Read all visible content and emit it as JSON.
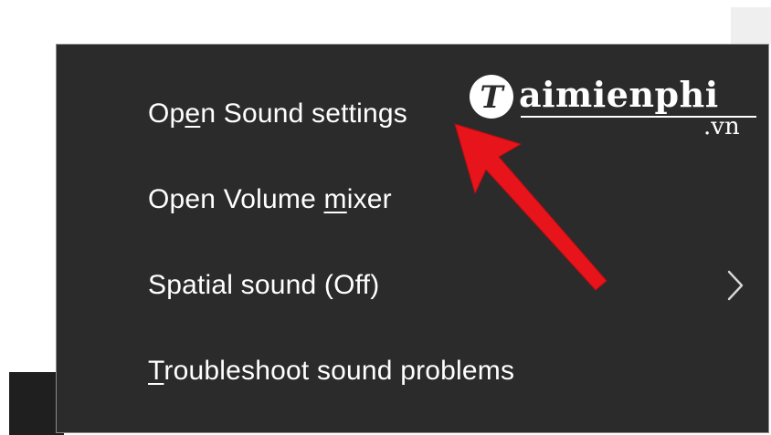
{
  "menu": {
    "items": [
      {
        "prefix": "Op",
        "accel": "e",
        "suffix": "n Sound settings",
        "has_submenu": false
      },
      {
        "prefix": "Open Volume ",
        "accel": "m",
        "suffix": "ixer",
        "has_submenu": false
      },
      {
        "prefix": "Spatial sound (Off)",
        "accel": "",
        "suffix": "",
        "has_submenu": true
      },
      {
        "prefix": "",
        "accel": "T",
        "suffix": "roubleshoot sound problems",
        "has_submenu": false
      }
    ],
    "submenu_icon": "chevron-right-icon"
  },
  "watermark": {
    "brand": "aimienphi",
    "logo_letter": "T",
    "suffix": ".vn"
  },
  "annotation": {
    "arrow_color": "#e8141b",
    "arrow_icon": "red-pointer-arrow"
  },
  "colors": {
    "menu_background": "#2b2b2b",
    "menu_border": "#8a8a8a",
    "text": "#ffffff"
  }
}
